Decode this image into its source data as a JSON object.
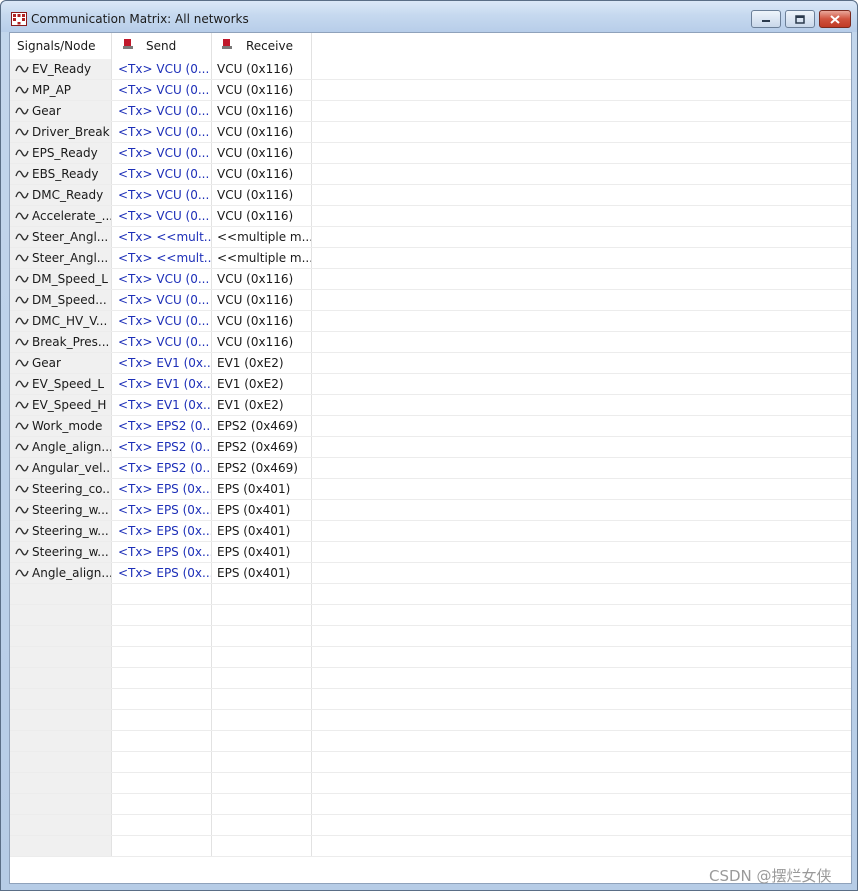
{
  "window": {
    "title": "Communication Matrix: All networks"
  },
  "columns": {
    "signals": "Signals/Node",
    "send": "Send",
    "receive": "Receive"
  },
  "rows": [
    {
      "signal": "EV_Ready",
      "send": "<Tx> VCU (0...",
      "receive": "VCU (0x116)"
    },
    {
      "signal": "MP_AP",
      "send": "<Tx> VCU (0...",
      "receive": "VCU (0x116)"
    },
    {
      "signal": "Gear",
      "send": "<Tx> VCU (0...",
      "receive": "VCU (0x116)"
    },
    {
      "signal": "Driver_Break",
      "send": "<Tx> VCU (0...",
      "receive": "VCU (0x116)"
    },
    {
      "signal": "EPS_Ready",
      "send": "<Tx> VCU (0...",
      "receive": "VCU (0x116)"
    },
    {
      "signal": "EBS_Ready",
      "send": "<Tx> VCU (0...",
      "receive": "VCU (0x116)"
    },
    {
      "signal": "DMC_Ready",
      "send": "<Tx> VCU (0...",
      "receive": "VCU (0x116)"
    },
    {
      "signal": "Accelerate_...",
      "send": "<Tx> VCU (0...",
      "receive": "VCU (0x116)"
    },
    {
      "signal": "Steer_Angl...",
      "send": "<Tx> <<mult...",
      "receive": "<<multiple m..."
    },
    {
      "signal": "Steer_Angl...",
      "send": "<Tx> <<mult...",
      "receive": "<<multiple m..."
    },
    {
      "signal": "DM_Speed_L",
      "send": "<Tx> VCU (0...",
      "receive": "VCU (0x116)"
    },
    {
      "signal": "DM_Speed...",
      "send": "<Tx> VCU (0...",
      "receive": "VCU (0x116)"
    },
    {
      "signal": "DMC_HV_V...",
      "send": "<Tx> VCU (0...",
      "receive": "VCU (0x116)"
    },
    {
      "signal": "Break_Pres...",
      "send": "<Tx> VCU (0...",
      "receive": "VCU (0x116)"
    },
    {
      "signal": "Gear",
      "send": "<Tx> EV1 (0x...",
      "receive": "EV1 (0xE2)"
    },
    {
      "signal": "EV_Speed_L",
      "send": "<Tx> EV1 (0x...",
      "receive": "EV1 (0xE2)"
    },
    {
      "signal": "EV_Speed_H",
      "send": "<Tx> EV1 (0x...",
      "receive": "EV1 (0xE2)"
    },
    {
      "signal": "Work_mode",
      "send": "<Tx> EPS2 (0...",
      "receive": "EPS2 (0x469)"
    },
    {
      "signal": "Angle_align...",
      "send": "<Tx> EPS2 (0...",
      "receive": "EPS2 (0x469)"
    },
    {
      "signal": "Angular_vel...",
      "send": "<Tx> EPS2 (0...",
      "receive": "EPS2 (0x469)"
    },
    {
      "signal": "Steering_co...",
      "send": "<Tx> EPS (0x...",
      "receive": "EPS (0x401)"
    },
    {
      "signal": "Steering_w...",
      "send": "<Tx> EPS (0x...",
      "receive": "EPS (0x401)"
    },
    {
      "signal": "Steering_w...",
      "send": "<Tx> EPS (0x...",
      "receive": "EPS (0x401)"
    },
    {
      "signal": "Steering_w...",
      "send": "<Tx> EPS (0x...",
      "receive": "EPS (0x401)"
    },
    {
      "signal": "Angle_align...",
      "send": "<Tx> EPS (0x...",
      "receive": "EPS (0x401)"
    }
  ],
  "watermark": "CSDN @摆烂女侠",
  "icons": {
    "app": "matrix-grid-icon",
    "node": "node-icon",
    "signal": "signal-wave-icon"
  },
  "colors": {
    "send_text": "#1d2fb8",
    "title_bar": "#c6d9ef",
    "close_button": "#c03a25"
  }
}
